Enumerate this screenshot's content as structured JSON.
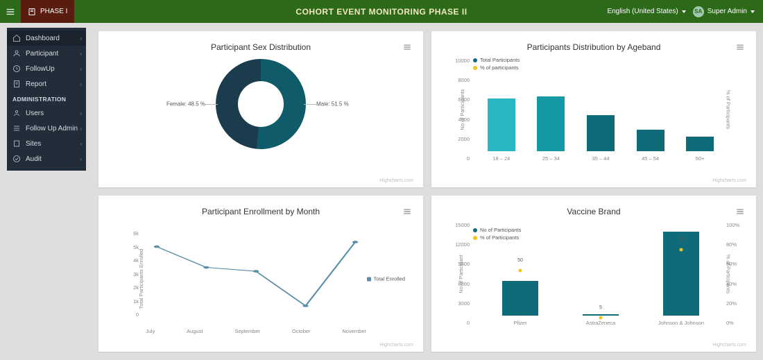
{
  "header": {
    "phase_button": "PHASE I",
    "title": "COHORT EVENT MONITORING PHASE II",
    "language": "English (United States)",
    "avatar_initials": "SA",
    "user": "Super Admin"
  },
  "sidebar": {
    "items": [
      {
        "icon": "home-icon",
        "label": "Dashboard"
      },
      {
        "icon": "users-icon",
        "label": "Participant"
      },
      {
        "icon": "clock-icon",
        "label": "FollowUp"
      },
      {
        "icon": "doc-icon",
        "label": "Report"
      }
    ],
    "admin_header": "ADMINISTRATION",
    "admin_items": [
      {
        "icon": "user-icon",
        "label": "Users"
      },
      {
        "icon": "list-icon",
        "label": "Follow Up Admin"
      },
      {
        "icon": "site-icon",
        "label": "Sites"
      },
      {
        "icon": "audit-icon",
        "label": "Audit"
      }
    ]
  },
  "credit": "Highcharts.com",
  "colors": {
    "primary_dark": "#0f5b69",
    "primary": "#0f6a7a",
    "accent_light": "#27b8c3",
    "accent_mid": "#159aa5",
    "secondary": "#f0c419"
  },
  "cards": {
    "sex": {
      "title": "Participant Sex Distribution",
      "female_label": "Female: 48.5 %",
      "male_label": "Male: 51.5 %"
    },
    "age": {
      "title": "Participants Distribution by Ageband",
      "ylabel": "No of Participants",
      "y2label": "% of Participants",
      "legend1": "Total Participants",
      "legend2": "% of participants"
    },
    "enroll": {
      "title": "Participant Enrollment by Month",
      "ylabel": "Total Participants Enrolled",
      "legend": "Total Enrolled"
    },
    "brand": {
      "title": "Vaccine Brand",
      "ylabel": "No of Participant",
      "y2label": "% of Participants",
      "legend1": "No of Participants",
      "legend2": "% of Participants",
      "marker1": "50",
      "marker2": "5",
      "marker3": "70"
    }
  },
  "chart_data": [
    {
      "type": "pie",
      "title": "Participant Sex Distribution",
      "data": [
        {
          "name": "Male",
          "value": 51.5
        },
        {
          "name": "Female",
          "value": 48.5
        }
      ]
    },
    {
      "type": "bar",
      "title": "Participants Distribution by Ageband",
      "categories": [
        "18 – 24",
        "25 – 34",
        "35 – 44",
        "45 – 54",
        "50+"
      ],
      "series": [
        {
          "name": "Total Participants",
          "values": [
            5100,
            5300,
            3500,
            2050,
            1400
          ]
        }
      ],
      "ylabel": "No of Participants",
      "ylim": [
        0,
        10000
      ],
      "yticks": [
        0,
        2000,
        4000,
        6000,
        8000,
        10000
      ],
      "y2label": "% of Participants"
    },
    {
      "type": "line",
      "title": "Participant Enrollment by Month",
      "categories": [
        "July",
        "August",
        "September",
        "October",
        "November"
      ],
      "series": [
        {
          "name": "Total Enrolled",
          "values": [
            4800,
            3450,
            3200,
            950,
            5100
          ]
        }
      ],
      "ylabel": "Total Participants Enrolled",
      "ylim": [
        0,
        6000
      ],
      "yticks": [
        0,
        1000,
        2000,
        3000,
        4000,
        5000,
        6000
      ]
    },
    {
      "type": "bar",
      "title": "Vaccine Brand",
      "categories": [
        "Pfizer",
        "AstraZeneca",
        "Johnson & Johnson"
      ],
      "series": [
        {
          "name": "No of Participants",
          "values": [
            5000,
            200,
            12100
          ]
        },
        {
          "name": "% of Participants",
          "values": [
            50,
            5,
            70
          ]
        }
      ],
      "ylabel": "No of Participant",
      "ylim": [
        0,
        15000
      ],
      "yticks": [
        0,
        3000,
        6000,
        9000,
        12000,
        15000
      ],
      "y2label": "% of Participants",
      "y2lim": [
        0,
        100
      ],
      "y2ticks": [
        0,
        20,
        40,
        60,
        80,
        100
      ]
    }
  ]
}
